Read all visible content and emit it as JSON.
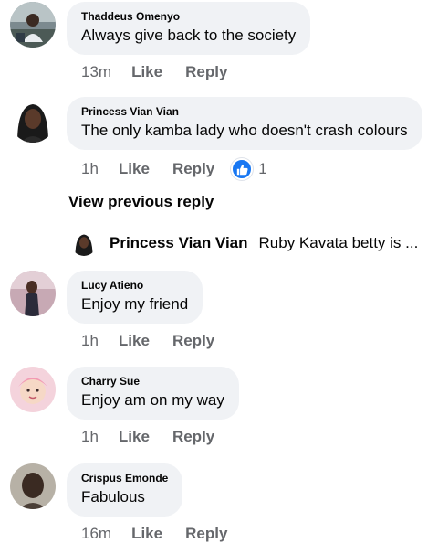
{
  "comments": [
    {
      "author": "Thaddeus Omenyo",
      "text": "Always give back to the society",
      "time": "13m",
      "like_label": "Like",
      "reply_label": "Reply",
      "avatar_icon": "user-photo-icon"
    },
    {
      "author": "Princess Vian Vian",
      "text": "The only kamba lady who doesn't crash colours",
      "time": "1h",
      "like_label": "Like",
      "reply_label": "Reply",
      "reaction_icon": "like-reaction-icon",
      "reaction_count": "1",
      "avatar_icon": "user-photo-icon"
    },
    {
      "author": "Lucy Atieno",
      "text": "Enjoy my friend",
      "time": "1h",
      "like_label": "Like",
      "reply_label": "Reply",
      "avatar_icon": "user-photo-icon"
    },
    {
      "author": "Charry Sue",
      "text": "Enjoy am on my way",
      "time": "1h",
      "like_label": "Like",
      "reply_label": "Reply",
      "avatar_icon": "user-photo-icon"
    },
    {
      "author": "Crispus Emonde",
      "text": "Fabulous",
      "time": "16m",
      "like_label": "Like",
      "reply_label": "Reply",
      "avatar_icon": "user-photo-icon"
    }
  ],
  "view_previous_reply": "View previous reply",
  "reply_preview": {
    "author": "Princess Vian Vian",
    "text": "Ruby Kavata betty is ..."
  },
  "colors": {
    "bubble_bg": "#f0f2f5",
    "secondary_text": "#65676b",
    "like_blue": "#1877f2",
    "primary_text": "#050505"
  }
}
